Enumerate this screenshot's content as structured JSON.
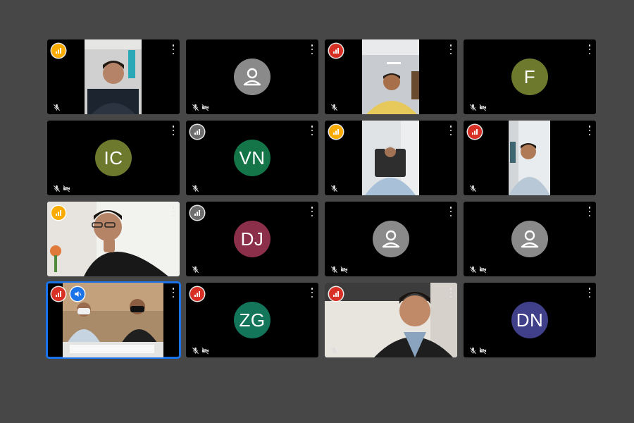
{
  "meeting": {
    "participants": [
      {
        "id": "p1",
        "initials": "",
        "avatar_color": "",
        "video": "man-room-left",
        "signal": "yellow",
        "status_icons": [
          "mic-off"
        ]
      },
      {
        "id": "p2",
        "initials": "",
        "avatar_color": "#8a8a8a",
        "video": "",
        "signal": "",
        "status_icons": [
          "mic-off",
          "camera-off"
        ]
      },
      {
        "id": "p3",
        "initials": "",
        "avatar_color": "",
        "video": "man-yellow-shirt",
        "signal": "red",
        "status_icons": [
          "mic-off"
        ]
      },
      {
        "id": "p4",
        "initials": "F",
        "avatar_color": "#6d7a2e",
        "video": "",
        "signal": "",
        "status_icons": [
          "mic-off",
          "camera-off"
        ]
      },
      {
        "id": "p5",
        "initials": "IC",
        "avatar_color": "#6d7a2e",
        "video": "",
        "signal": "",
        "status_icons": [
          "mic-off",
          "camera-off"
        ]
      },
      {
        "id": "p6",
        "initials": "VN",
        "avatar_color": "#137548",
        "video": "",
        "signal": "gray",
        "status_icons": [
          "mic-off"
        ]
      },
      {
        "id": "p7",
        "initials": "",
        "avatar_color": "",
        "video": "man-checked-shirt",
        "signal": "yellow",
        "status_icons": [
          "mic-off"
        ]
      },
      {
        "id": "p8",
        "initials": "",
        "avatar_color": "",
        "video": "man-light-shirt",
        "signal": "red",
        "status_icons": [
          "mic-off"
        ]
      },
      {
        "id": "p9",
        "initials": "",
        "avatar_color": "",
        "video": "man-glasses-closeup",
        "signal": "yellow",
        "status_icons": []
      },
      {
        "id": "p10",
        "initials": "DJ",
        "avatar_color": "#8c2f4b",
        "video": "",
        "signal": "gray",
        "status_icons": [
          "mic-off"
        ]
      },
      {
        "id": "p11",
        "initials": "",
        "avatar_color": "#8a8a8a",
        "video": "",
        "signal": "",
        "status_icons": [
          "mic-off",
          "camera-off"
        ]
      },
      {
        "id": "p12",
        "initials": "",
        "avatar_color": "#8a8a8a",
        "video": "",
        "signal": "",
        "status_icons": [
          "mic-off",
          "camera-off"
        ]
      },
      {
        "id": "p13",
        "initials": "",
        "avatar_color": "",
        "video": "two-men-desk",
        "signal": "red",
        "status_icons": [],
        "muted_badge": true,
        "active": true
      },
      {
        "id": "p14",
        "initials": "ZG",
        "avatar_color": "#137559",
        "video": "",
        "signal": "red",
        "status_icons": [
          "mic-off",
          "camera-off"
        ]
      },
      {
        "id": "p15",
        "initials": "",
        "avatar_color": "",
        "video": "man-suit-closeup",
        "signal": "red",
        "status_icons": [
          "mic-off"
        ]
      },
      {
        "id": "p16",
        "initials": "DN",
        "avatar_color": "#3f3f8a",
        "video": "",
        "signal": "",
        "status_icons": [
          "mic-off",
          "camera-off"
        ]
      }
    ]
  },
  "colors": {
    "background": "#474747",
    "tile": "#000000",
    "active_border": "#1a73e8",
    "signal_yellow": "#f9ab00",
    "signal_red": "#d93025",
    "signal_gray": "#6e6e6e"
  },
  "icons": {
    "signal": "signal-bars-icon",
    "mic_off": "mic-off-icon",
    "camera_off": "camera-off-icon",
    "more": "more-vert-icon",
    "generic_avatar": "person-icon",
    "muted_badge": "mic-muted-badge-icon"
  }
}
